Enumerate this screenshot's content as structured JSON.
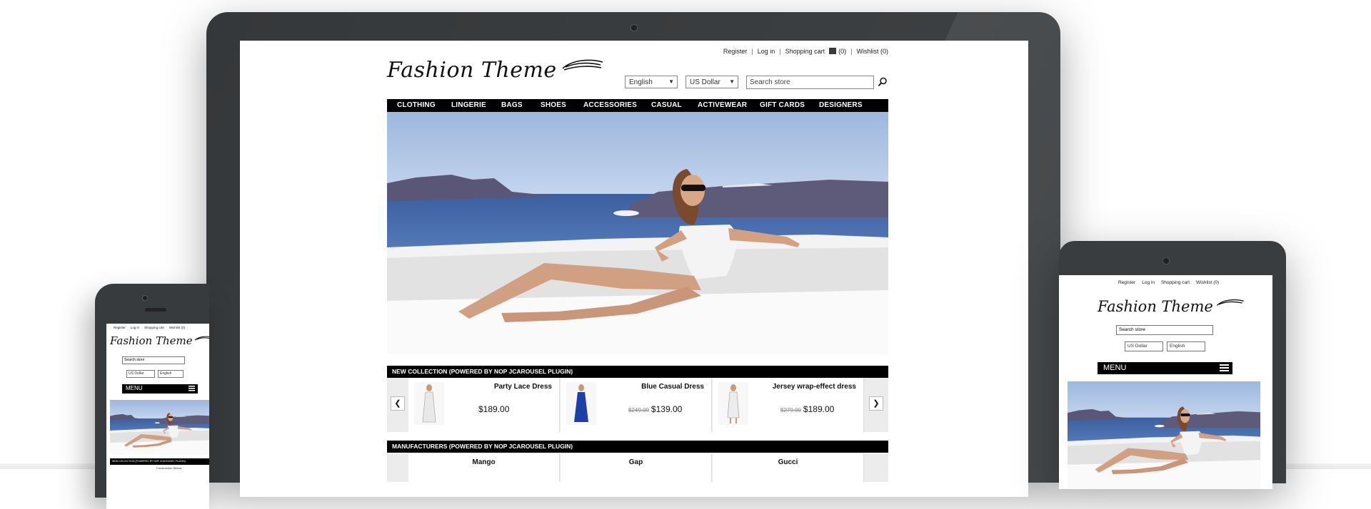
{
  "header": {
    "links": {
      "register": "Register",
      "login": "Log in",
      "cart": "Shopping cart",
      "cart_count": "(0)",
      "wishlist": "Wishlist (0)"
    },
    "logo": "Fashion Theme",
    "language": "English",
    "currency": "US Dollar",
    "search_placeholder": "Search store"
  },
  "nav": [
    "CLOTHING",
    "LINGERIE",
    "BAGS",
    "SHOES",
    "ACCESSORIES",
    "CASUAL",
    "ACTIVEWEAR",
    "GIFT CARDS",
    "DESIGNERS"
  ],
  "new_collection": {
    "title": "NEW COLLECTION (POWERED BY NOP JCAROUSEL PLUGIN)",
    "products": [
      {
        "name": "Party Lace Dress",
        "old_price": "",
        "price": "$189.00",
        "dress_color": "#e9e9e9"
      },
      {
        "name": "Blue Casual Dress",
        "old_price": "$249.00",
        "price": "$139.00",
        "dress_color": "#1f3fa8"
      },
      {
        "name": "Jersey wrap-effect dress",
        "old_price": "$279.00",
        "price": "$189.00",
        "dress_color": "#ececec"
      }
    ]
  },
  "manufacturers": {
    "title": "MANUFACTURERS (POWERED BY NOP JCAROUSEL PLUGIN)",
    "items": [
      "Mango",
      "Gap",
      "Gucci"
    ]
  },
  "tablet": {
    "menu_label": "MENU",
    "search_placeholder": "Search store",
    "currency": "US Dollar",
    "language": "English"
  },
  "phone": {
    "menu_label": "MENU",
    "search_placeholder": "Search store",
    "currency": "US Dollar",
    "language": "English",
    "section_title": "NEW COLLECTION (POWERED BY NOP JCAROUSEL PLUGIN)",
    "section_sub": "Construction Widow"
  },
  "colors": {
    "frame": "#3a3d3f",
    "nav_bg": "#000000",
    "sea": "#3e63a4",
    "sky": "#a9c3e6"
  }
}
